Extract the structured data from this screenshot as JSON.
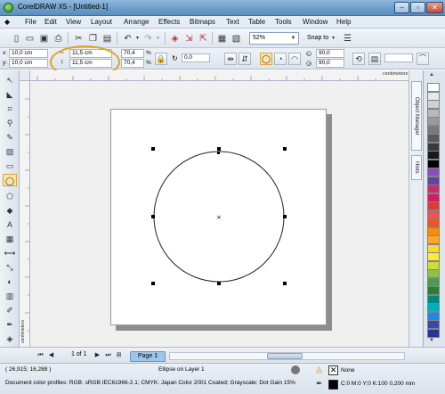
{
  "window": {
    "title": "CorelDRAW X5 - [Untitled-1]",
    "minimize": "‒",
    "restore": "▫",
    "close": "✕"
  },
  "menu": [
    "File",
    "Edit",
    "View",
    "Layout",
    "Arrange",
    "Effects",
    "Bitmaps",
    "Text",
    "Table",
    "Tools",
    "Window",
    "Help"
  ],
  "toolbar": {
    "zoom_level": "52%",
    "snap_to": "Snap to"
  },
  "property_bar": {
    "x_label": "x:",
    "x_value": "10,0 cm",
    "y_label": "y:",
    "y_value": "10,0 cm",
    "width_value": "11,5 cm",
    "height_value": "11,5 cm",
    "scale_x": "70,4",
    "scale_y": "70,4",
    "percent_label": "%",
    "rotation": "0,0",
    "start_angle": "90,0",
    "end_angle": "90,0"
  },
  "rulers": {
    "unit": "centimeters",
    "vertical_unit": "centimeters"
  },
  "docker": {
    "tabs": [
      "Object Manager",
      "Hints"
    ]
  },
  "palette": {
    "colors": [
      "#ffffff",
      "#e8e8e8",
      "#d0d0d0",
      "#b8b8b8",
      "#9a9a9a",
      "#7a7a7a",
      "#5a5a5a",
      "#3a3a3a",
      "#1a1a1a",
      "#000000",
      "#8a4fb3",
      "#6b3fa0",
      "#c0306a",
      "#d81b60",
      "#e53935",
      "#ef5350",
      "#f4511e",
      "#fb8c00",
      "#ffa726",
      "#fdd835",
      "#ffeb3b",
      "#cddc39",
      "#8bc34a",
      "#43a047",
      "#2e7d32",
      "#00897b",
      "#00acc1",
      "#1e88e5",
      "#3949ab",
      "#283593"
    ]
  },
  "page_nav": {
    "page_counter": "1 of 1",
    "page_tab": "Page 1"
  },
  "status": {
    "cursor_position": "( 26,915; 16,288 )",
    "object_info": "Ellipse on Layer 1",
    "color_profiles": "Document color profiles: RGB: sRGB IEC61966-2.1; CMYK: Japan Color 2001 Coated; Grayscale: Dot Gain 15%",
    "fill_label": "None",
    "outline_label": "C:0 M:0 Y:0 K:100  0,200 mm"
  },
  "icons": {
    "new": "new-document-icon",
    "open": "open-icon",
    "save": "save-icon",
    "print": "print-icon",
    "cut": "cut-icon",
    "copy": "copy-icon",
    "paste": "paste-icon",
    "undo": "undo-icon",
    "redo": "redo-icon"
  }
}
